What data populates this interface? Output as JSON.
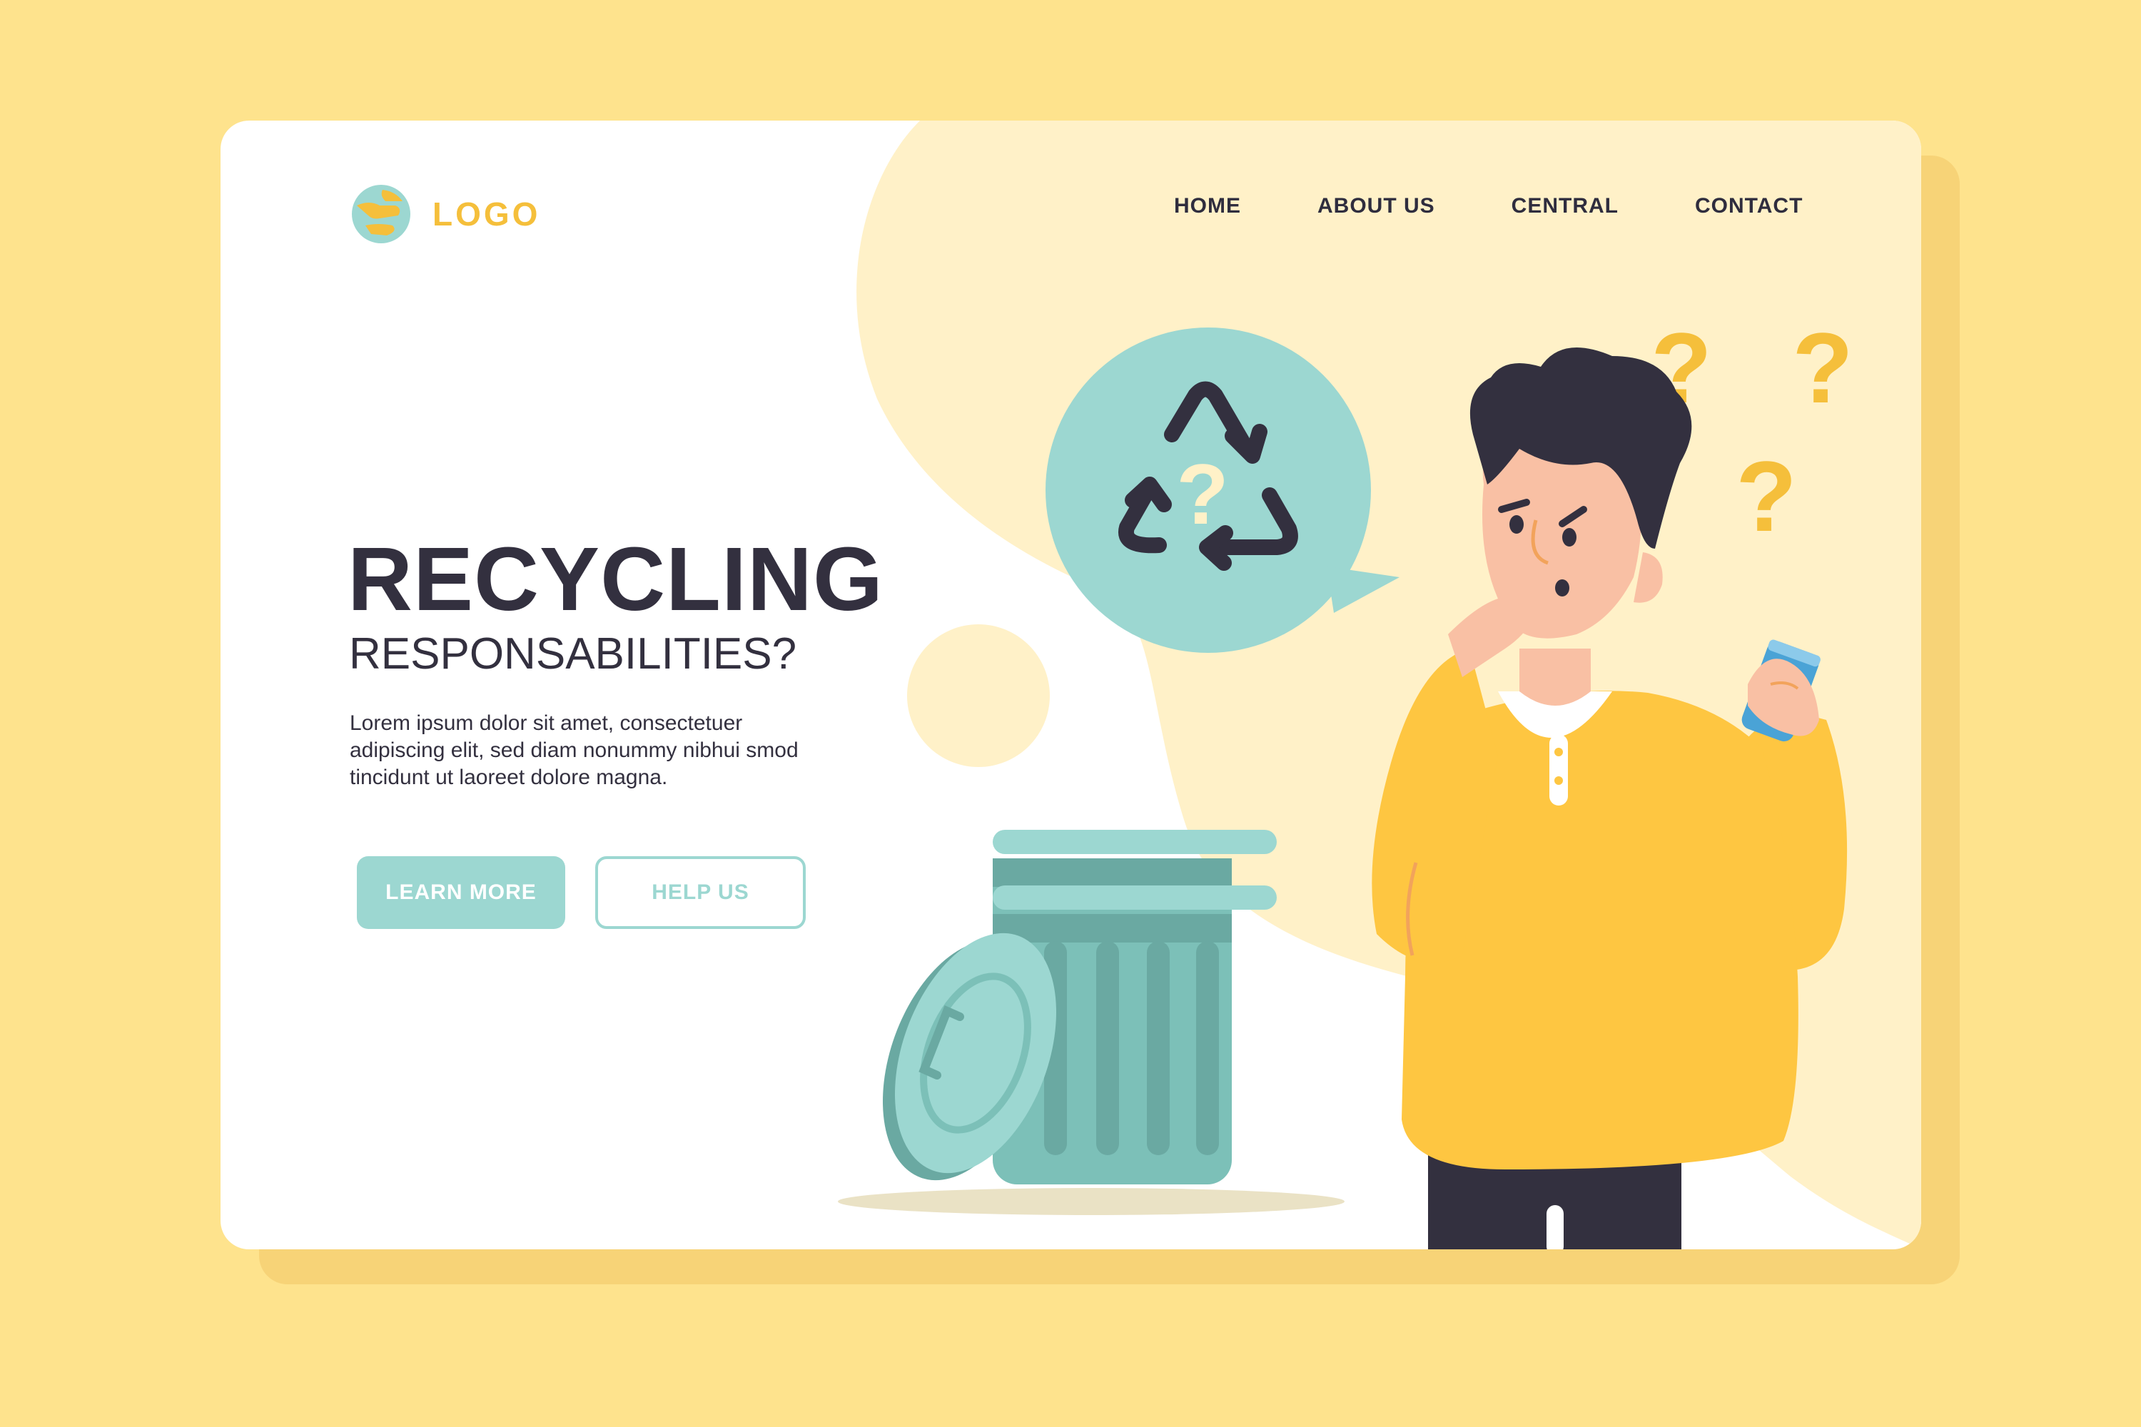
{
  "brand": {
    "logo_text": "LOGO"
  },
  "nav": {
    "items": [
      {
        "label": "HOME"
      },
      {
        "label": "ABOUT US"
      },
      {
        "label": "CENTRAL"
      },
      {
        "label": "CONTACT"
      }
    ]
  },
  "hero": {
    "title": "RECYCLING",
    "subtitle": "RESPONSABILITIES?",
    "body": "Lorem ipsum dolor sit amet, consectetuer adipiscing elit, sed diam nonummy nibhui smod tincidunt ut laoreet dolore magna."
  },
  "buttons": {
    "learn_more": "LEARN MORE",
    "help_us": "HELP US"
  },
  "illustration": {
    "question_mark": "?",
    "icons": [
      "recycle-icon",
      "trash-can-icon",
      "soda-can-icon",
      "question-mark-icon"
    ]
  },
  "colors": {
    "background": "#fee38d",
    "accent_yellow": "#f5bf3b",
    "teal": "#9cd7d1",
    "dark_text": "#33303f",
    "sweater": "#fec641"
  }
}
